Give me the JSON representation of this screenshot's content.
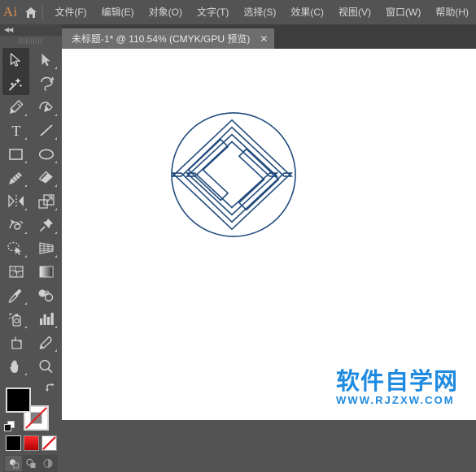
{
  "app": {
    "name": "Adobe Illustrator",
    "logo_text": "Ai",
    "logo_color": "#d98c50",
    "chrome_bg": "#535353",
    "panel_bg": "#454545",
    "canvas_bg": "#ffffff"
  },
  "menubar": {
    "home_icon": "home-icon",
    "items": [
      {
        "label": "文件(F)",
        "name": "menu-file"
      },
      {
        "label": "编辑(E)",
        "name": "menu-edit"
      },
      {
        "label": "对象(O)",
        "name": "menu-object"
      },
      {
        "label": "文字(T)",
        "name": "menu-type"
      },
      {
        "label": "选择(S)",
        "name": "menu-select"
      },
      {
        "label": "效果(C)",
        "name": "menu-effect"
      },
      {
        "label": "视图(V)",
        "name": "menu-view"
      },
      {
        "label": "窗口(W)",
        "name": "menu-window"
      },
      {
        "label": "帮助(H)",
        "name": "menu-help"
      }
    ]
  },
  "document_tab": {
    "title": "未标题-1* @ 110.54% (CMYK/GPU 预览)",
    "file_name": "未标题-1",
    "modified": true,
    "zoom_level": "110.54%",
    "color_mode": "CMYK",
    "render_mode": "GPU 预览",
    "close_label": "✕"
  },
  "toolpanel": {
    "collapse_label": "◀◀",
    "tools": [
      {
        "name": "selection-tool",
        "icon": "arrow-solid-icon",
        "active": true,
        "has_flyout": false
      },
      {
        "name": "direct-selection-tool",
        "icon": "arrow-white-icon",
        "active": false,
        "has_flyout": true
      },
      {
        "name": "magic-wand-tool",
        "icon": "magic-wand-icon",
        "active": true,
        "has_flyout": false
      },
      {
        "name": "lasso-tool",
        "icon": "lasso-icon",
        "active": false,
        "has_flyout": false
      },
      {
        "name": "pen-tool",
        "icon": "pen-icon",
        "active": false,
        "has_flyout": true
      },
      {
        "name": "curvature-tool",
        "icon": "curvature-pen-icon",
        "active": false,
        "has_flyout": true
      },
      {
        "name": "type-tool",
        "icon": "type-t-icon",
        "active": false,
        "has_flyout": true
      },
      {
        "name": "line-segment-tool",
        "icon": "line-diagonal-icon",
        "active": false,
        "has_flyout": true
      },
      {
        "name": "rectangle-tool",
        "icon": "rectangle-icon",
        "active": false,
        "has_flyout": true
      },
      {
        "name": "ellipse-tool",
        "icon": "ellipse-icon",
        "active": false,
        "has_flyout": true
      },
      {
        "name": "paintbrush-tool",
        "icon": "paintbrush-icon",
        "active": false,
        "has_flyout": true
      },
      {
        "name": "eraser-tool",
        "icon": "eraser-icon",
        "active": false,
        "has_flyout": true
      },
      {
        "name": "reflect-rotate-tool",
        "icon": "reflect-icon",
        "active": false,
        "has_flyout": true
      },
      {
        "name": "scale-tool",
        "icon": "scale-icon",
        "active": false,
        "has_flyout": true
      },
      {
        "name": "width-warp-tool",
        "icon": "width-tool-icon",
        "active": false,
        "has_flyout": true
      },
      {
        "name": "free-transform-tool",
        "icon": "pushpin-icon",
        "active": false,
        "has_flyout": false
      },
      {
        "name": "shape-builder-tool",
        "icon": "shape-builder-icon",
        "active": false,
        "has_flyout": true
      },
      {
        "name": "perspective-grid-tool",
        "icon": "perspective-grid-icon",
        "active": false,
        "has_flyout": true
      },
      {
        "name": "mesh-tool",
        "icon": "mesh-icon",
        "active": false,
        "has_flyout": false
      },
      {
        "name": "gradient-tool",
        "icon": "gradient-icon",
        "active": false,
        "has_flyout": false
      },
      {
        "name": "eyedropper-tool",
        "icon": "eyedropper-icon",
        "active": false,
        "has_flyout": true
      },
      {
        "name": "blend-tool",
        "icon": "blend-icon",
        "active": false,
        "has_flyout": false
      },
      {
        "name": "symbol-sprayer-tool",
        "icon": "symbol-sprayer-icon",
        "active": false,
        "has_flyout": true
      },
      {
        "name": "column-graph-tool",
        "icon": "bar-chart-icon",
        "active": false,
        "has_flyout": true
      },
      {
        "name": "artboard-tool",
        "icon": "artboard-icon",
        "active": false,
        "has_flyout": false
      },
      {
        "name": "slice-tool",
        "icon": "knife-icon",
        "active": false,
        "has_flyout": true
      },
      {
        "name": "hand-tool",
        "icon": "hand-icon",
        "active": false,
        "has_flyout": true
      },
      {
        "name": "zoom-tool",
        "icon": "magnifier-icon",
        "active": false,
        "has_flyout": false
      }
    ],
    "color_controls": {
      "fill_label": "填色",
      "fill_color": "#000000",
      "stroke_label": "描边",
      "stroke_color": "none",
      "swap_icon": "swap-fill-stroke-icon",
      "default_icon": "default-fill-stroke-icon"
    },
    "color_modes": [
      {
        "name": "color-mode-button",
        "icon": "solid-color-icon",
        "selected": true,
        "color": "#000000"
      },
      {
        "name": "gradient-mode-button",
        "icon": "gradient-icon",
        "selected": false,
        "color": "#ff2a2a"
      },
      {
        "name": "none-mode-button",
        "icon": "none-slash-icon",
        "selected": false,
        "color": "#ffffff"
      }
    ],
    "draw_modes": [
      {
        "name": "draw-normal-button",
        "icon": "draw-normal-icon",
        "selected": true
      },
      {
        "name": "draw-behind-button",
        "icon": "draw-behind-icon",
        "selected": false
      },
      {
        "name": "draw-inside-button",
        "icon": "draw-inside-icon",
        "selected": false
      }
    ]
  },
  "canvas": {
    "artwork_name": "geometric-s-logo",
    "artwork_description": "nested diamond maze forming letter S inside a circle",
    "stroke_color": "#1f4a7d",
    "fill_color": "none"
  },
  "watermark": {
    "chinese_text": "软件自学网",
    "url_text": "WWW.RJZXW.COM",
    "color": "#1e8ae0"
  }
}
